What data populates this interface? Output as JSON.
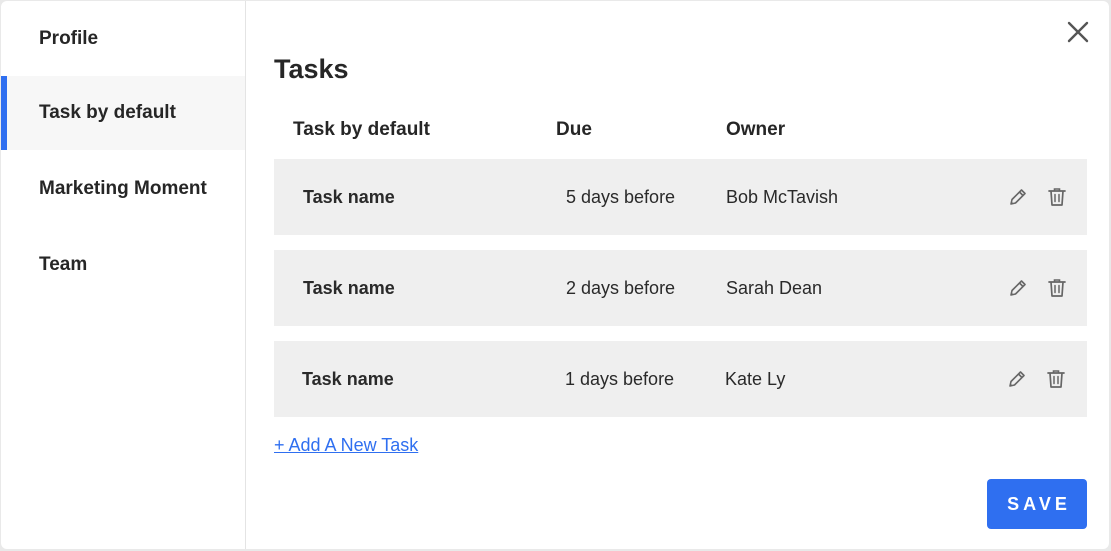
{
  "sidebar": {
    "items": [
      {
        "label": "Profile",
        "active": false
      },
      {
        "label": "Task by default",
        "active": true
      },
      {
        "label": "Marketing Moment",
        "active": false
      },
      {
        "label": "Team",
        "active": false
      }
    ],
    "accent_color": "#2f6ff0"
  },
  "main": {
    "title": "Tasks",
    "columns": [
      "Task by default",
      "Due",
      "Owner"
    ],
    "rows": [
      {
        "name": "Task name",
        "due": "5 days before",
        "owner": "Bob McTavish",
        "actions": [
          "pencil-icon",
          "trash-icon"
        ]
      },
      {
        "name": "Task name",
        "due": "2 days before",
        "owner": "Sarah Dean",
        "actions": [
          "pencil-icon",
          "trash-icon"
        ]
      },
      {
        "name": "Task name",
        "due": "1 days before",
        "owner": "Kate Ly",
        "actions": [
          "pencil-icon",
          "trash-icon"
        ]
      }
    ],
    "add_link": "+ Add A New Task",
    "save_label": "SAVE",
    "close_icon": "close-icon"
  }
}
